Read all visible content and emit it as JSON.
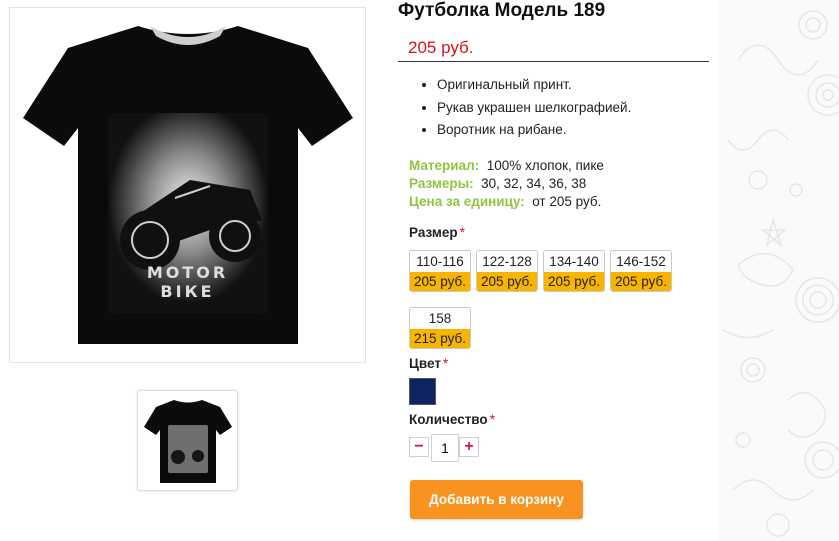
{
  "product": {
    "title": "Футболка Модель 189",
    "price": "205 руб.",
    "features": [
      "Оригинальный принт.",
      "Рукав украшен шелкографией.",
      "Воротник на рибане."
    ],
    "specs": [
      {
        "label": "Материал:",
        "value": "100% хлопок, пике"
      },
      {
        "label": "Размеры:",
        "value": "30, 32, 34, 36, 38"
      },
      {
        "label": "Цена за единицу:",
        "value": "от 205 руб."
      }
    ],
    "print_text": "МОТОR ВІКЕ"
  },
  "options": {
    "size_label": "Размер",
    "required_mark": "*",
    "sizes": [
      {
        "size": "110-116",
        "price": "205 руб."
      },
      {
        "size": "122-128",
        "price": "205 руб."
      },
      {
        "size": "134-140",
        "price": "205 руб."
      },
      {
        "size": "146-152",
        "price": "205 руб."
      },
      {
        "size": "158",
        "price": "215 руб."
      }
    ],
    "color_label": "Цвет",
    "color_value": "#0c2460",
    "qty_label": "Количество",
    "qty_minus": "−",
    "qty_plus": "+",
    "qty_value": "1"
  },
  "actions": {
    "add_to_cart": "Добавить в корзину"
  },
  "colors": {
    "price": "#d4141a",
    "spec_label": "#8cc63f",
    "size_price_bg": "#f7b500",
    "button": "#f7931e"
  }
}
